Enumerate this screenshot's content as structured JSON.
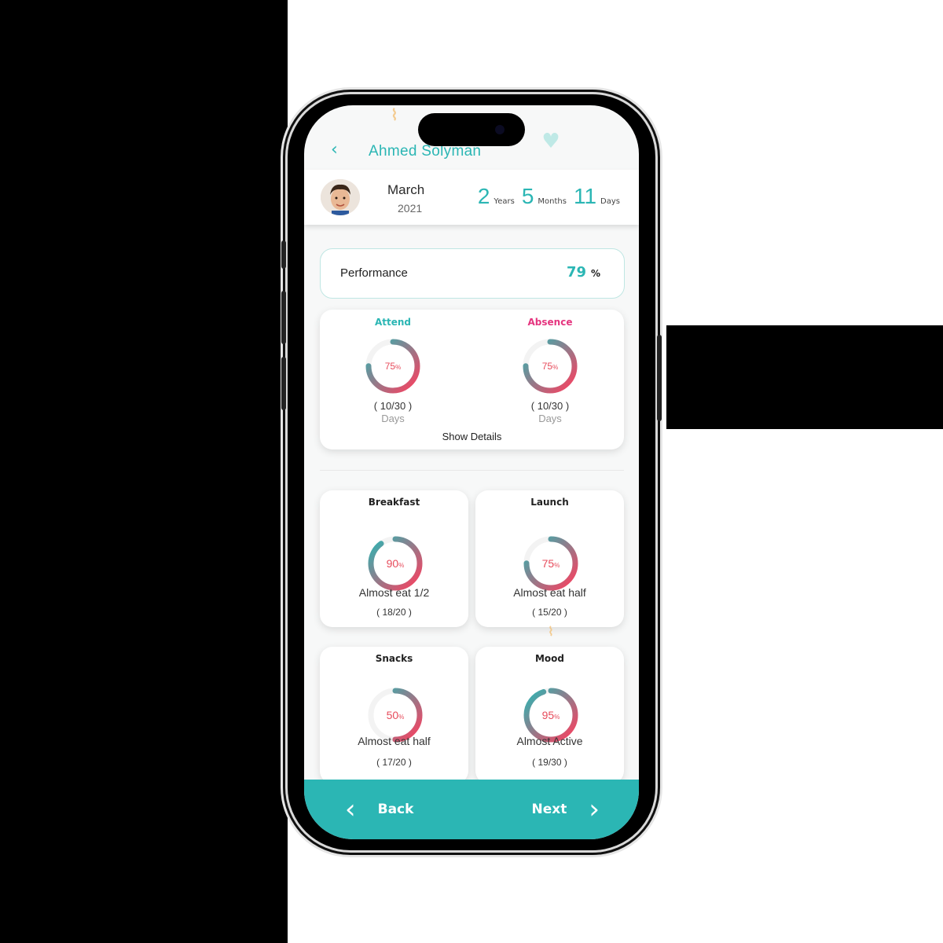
{
  "header": {
    "back_icon": "chevron-left-icon",
    "child_name": "Ahmed Solyman"
  },
  "info_bar": {
    "month": "March",
    "year": "2021",
    "age": [
      {
        "value": "2",
        "unit": "Years"
      },
      {
        "value": "5",
        "unit": "Months"
      },
      {
        "value": "11",
        "unit": "Days"
      }
    ]
  },
  "performance": {
    "label": "Performance",
    "value": "79",
    "unit": "%"
  },
  "attendance": {
    "attend": {
      "title": "Attend",
      "title_color": "#2bb6b4",
      "percent": 75,
      "percent_text": "75",
      "fraction": "( 10/30 )",
      "unit": "Days"
    },
    "absence": {
      "title": "Absence",
      "title_color": "#e5357f",
      "percent": 75,
      "percent_text": "75",
      "fraction": "( 10/30 )",
      "unit": "Days"
    },
    "show_details": "Show Details"
  },
  "meals": [
    {
      "title": "Breakfast",
      "percent": 90,
      "percent_text": "90",
      "status": "Almost eat 1/2",
      "fraction": "( 18/20 )"
    },
    {
      "title": "Launch",
      "percent": 75,
      "percent_text": "75",
      "status": "Almost eat half",
      "fraction": "( 15/20 )"
    },
    {
      "title": "Snacks",
      "percent": 50,
      "percent_text": "50",
      "status": "Almost eat half",
      "fraction": "( 17/20 )"
    },
    {
      "title": "Mood",
      "percent": 95,
      "percent_text": "95",
      "status": "Almost Active",
      "fraction": "( 19/30 )"
    }
  ],
  "percent_sign": "%",
  "bottom_nav": {
    "back_label": "Back",
    "next_label": "Next"
  },
  "colors": {
    "accent": "#2bb6b4",
    "ring_start": "#ff3d5e",
    "ring_end": "#2bb6b4",
    "absence": "#e5357f"
  }
}
